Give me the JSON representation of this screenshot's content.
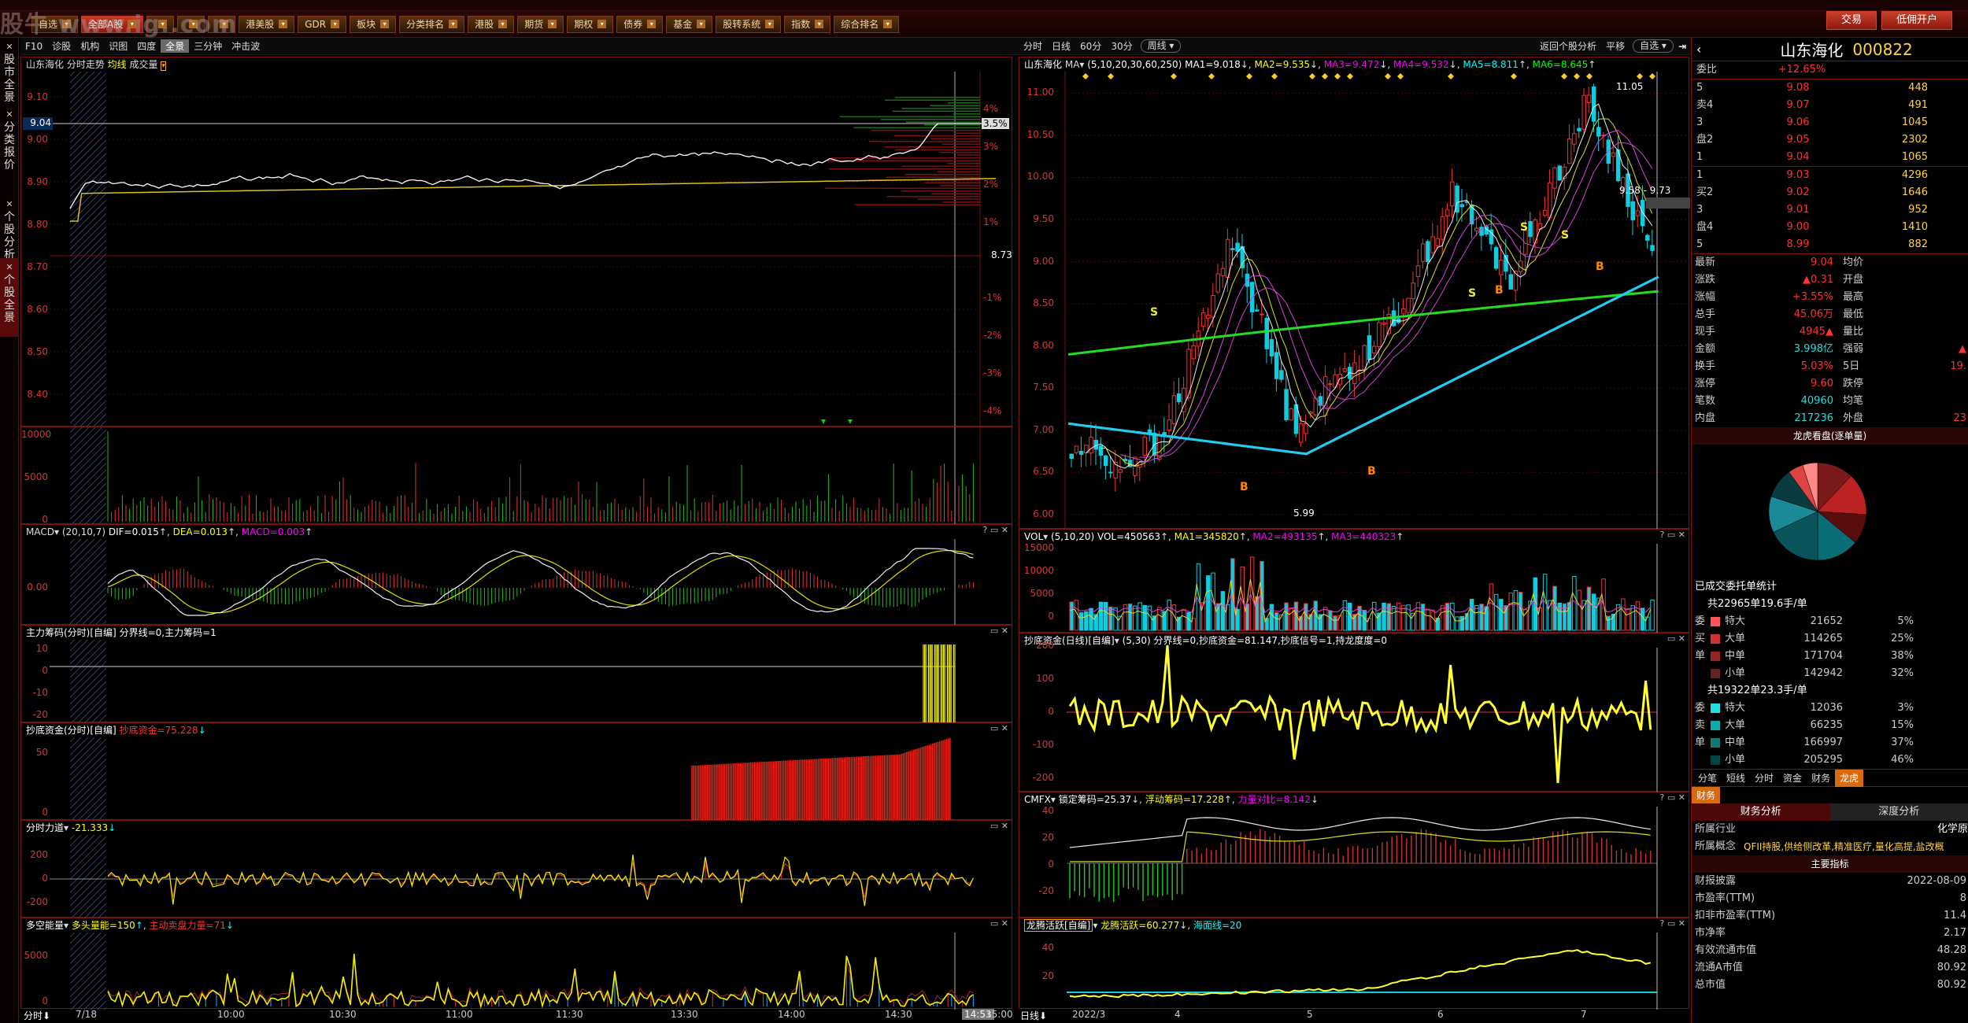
{
  "app": {
    "logo": "股牛 www.ig..com",
    "top_menu": [
      "自选",
      "全部A股",
      "",
      "",
      "",
      "港美股",
      "GDR",
      "板块",
      "分类排名",
      "港股",
      "期货",
      "期权",
      "债券",
      "基金",
      "股转系统",
      "指数",
      "综合排名"
    ],
    "trade_buttons": [
      "交易",
      "低佣开户"
    ]
  },
  "left_tabs": [
    {
      "label": "股市全景"
    },
    {
      "label": "分类报价"
    },
    {
      "label": "个股分析"
    },
    {
      "label": "个股全景"
    }
  ],
  "left_toolbar": [
    "F10",
    "诊股",
    "机构",
    "识图",
    "四度",
    "全景",
    "三分钟",
    "冲击波"
  ],
  "mid_toolbar": {
    "tabs": [
      "分时",
      "日线",
      "60分",
      "30分"
    ],
    "period_select": "周线",
    "right_links": [
      "返回个股分析",
      "平移"
    ],
    "watch_select": "自选"
  },
  "intraday": {
    "title": "山东海化 分时走势",
    "avg_label": "均线",
    "vol_label": "成交量",
    "price_axis": [
      "9.10",
      "9.00",
      "8.90",
      "8.80",
      "8.70",
      "8.60",
      "8.50",
      "8.40"
    ],
    "current_price_tag": "9.04",
    "pct_axis": [
      "4%",
      "3%",
      "2%",
      "1%",
      "",
      "-1%",
      "-2%",
      "-3%",
      "-4%"
    ],
    "pct_tag": "3.5%",
    "preclose_label": "8.73",
    "vol_axis": [
      "10000",
      "5000",
      "0"
    ],
    "macd": {
      "title": "MACD",
      "params": "(20,10,7)",
      "dif": "DIF=0.015",
      "dea": "DEA=0.013",
      "macd": "MACD=0.003",
      "axis": [
        "0.00"
      ]
    },
    "zlcm": {
      "title": "主力筹码(分时)[自编]",
      "params": "分界线=0,主力筹码=1",
      "axis": [
        "10",
        "0",
        "-10",
        "-20"
      ]
    },
    "cdzj": {
      "title": "抄底资金(分时)[自编]",
      "params": "抄底资金=75.228",
      "axis": [
        "50",
        "0"
      ]
    },
    "fsld": {
      "title": "分时力道",
      "params": "-21.333",
      "axis": [
        "200",
        "0",
        "-200"
      ]
    },
    "dknl": {
      "title": "多空能量",
      "params": "多头量能=150",
      "params2": "主动卖盘力量=71",
      "axis": [
        "5000",
        "0"
      ]
    },
    "time_axis": [
      "7/18",
      "10:00",
      "10:30",
      "11:00",
      "11:30",
      "13:30",
      "14:00",
      "14:30",
      "14:53",
      "15:00"
    ],
    "time_btn": "分时"
  },
  "daily": {
    "title": "山东海化",
    "ma_label": "MA",
    "ma_params": "(5,10,20,30,60,250)",
    "ma": [
      "MA1=9.018",
      "MA2=9.535",
      "MA3=9.472",
      "MA4=9.532",
      "MA5=8.811",
      "MA6=8.645"
    ],
    "price_axis": [
      "11.00",
      "10.50",
      "10.00",
      "9.50",
      "9.00",
      "8.50",
      "8.00",
      "7.50",
      "7.00",
      "6.50",
      "6.00"
    ],
    "high_label": "11.05",
    "low_label": "5.99",
    "range_label": "9.58 - 9.73",
    "vol": {
      "title": "VOL",
      "params": "(5,10,20)",
      "v": "VOL=450563",
      "ma1": "MA1=345820",
      "ma2": "MA2=493135",
      "ma3": "MA3=440323",
      "axis": [
        "15000",
        "10000",
        "5000",
        "0"
      ]
    },
    "cdzj": {
      "title": "抄底资金(日线)[自编]",
      "params": "(5,30)",
      "body": "分界线=0,抄底资金=81.147,抄底信号=1,持龙度度=0",
      "axis": [
        "200",
        "100",
        "0",
        "-100",
        "-200"
      ]
    },
    "cmfx": {
      "title": "CMFX",
      "lock": "锁定筹码=25.37",
      "float": "浮动筹码=17.228",
      "ratio": "力量对比=8.142",
      "axis": [
        "40",
        "20",
        "0",
        "-20"
      ]
    },
    "ltnh": {
      "title": "龙腾活跃[自编]",
      "body": "龙腾活跃=60.277",
      "sea": "海面线=20",
      "axis": [
        "40",
        "20"
      ]
    },
    "x_axis": [
      "2022/3",
      "4",
      "5",
      "6",
      "7"
    ],
    "period_btn": "日线"
  },
  "quote": {
    "name": "山东海化",
    "code": "000822",
    "webi_label": "委比",
    "webi": "+12.65%",
    "asks": [
      {
        "l": "5",
        "p": "9.08",
        "v": "448"
      },
      {
        "l": "卖4",
        "p": "9.07",
        "v": "491"
      },
      {
        "l": "3",
        "p": "9.06",
        "v": "1045"
      },
      {
        "l": "盘2",
        "p": "9.05",
        "v": "2302"
      },
      {
        "l": "1",
        "p": "9.04",
        "v": "1065"
      }
    ],
    "bids": [
      {
        "l": "1",
        "p": "9.03",
        "v": "4296"
      },
      {
        "l": "买2",
        "p": "9.02",
        "v": "1646"
      },
      {
        "l": "3",
        "p": "9.01",
        "v": "952"
      },
      {
        "l": "盘4",
        "p": "9.00",
        "v": "1410"
      },
      {
        "l": "5",
        "p": "8.99",
        "v": "882"
      }
    ],
    "stats": [
      [
        "最新",
        "9.04",
        "均价",
        ""
      ],
      [
        "涨跌",
        "▲0.31",
        "开盘",
        ""
      ],
      [
        "涨幅",
        "+3.55%",
        "最高",
        ""
      ],
      [
        "总手",
        "45.06万",
        "最低",
        ""
      ],
      [
        "现手",
        "4945▲",
        "量比",
        ""
      ],
      [
        "金额",
        "3.998亿",
        "强弱",
        "▲"
      ],
      [
        "换手",
        "5.03%",
        "5日",
        "19."
      ],
      [
        "涨停",
        "9.60",
        "跌停",
        ""
      ],
      [
        "笔数",
        "40960",
        "均笔",
        ""
      ],
      [
        "内盘",
        "217236",
        "外盘",
        "23"
      ]
    ],
    "pie_title": "龙虎看盘(逐单量)",
    "pie": [
      {
        "v": 12,
        "c": "#7a1a1a"
      },
      {
        "v": 14,
        "c": "#b22"
      },
      {
        "v": 10,
        "c": "#5a0d0d"
      },
      {
        "v": 14,
        "c": "#0b6d76"
      },
      {
        "v": 18,
        "c": "#0a555c"
      },
      {
        "v": 12,
        "c": "#1a8a96"
      },
      {
        "v": 10,
        "c": "#083c40"
      },
      {
        "v": 5,
        "c": "#d44"
      },
      {
        "v": 5,
        "c": "#f88"
      }
    ],
    "order_title": "已成交委托单统计",
    "buy_total": "共22965单19.6手/单",
    "buy": [
      {
        "s": "委",
        "n": "特大",
        "v": "21652",
        "p": "5%",
        "c": "#f55"
      },
      {
        "s": "买",
        "n": "大单",
        "v": "114265",
        "p": "25%",
        "c": "#c33"
      },
      {
        "s": "单",
        "n": "中单",
        "v": "171704",
        "p": "38%",
        "c": "#922"
      },
      {
        "s": "",
        "n": "小单",
        "v": "142942",
        "p": "32%",
        "c": "#622"
      }
    ],
    "sell_total": "共19322单23.3手/单",
    "sell": [
      {
        "s": "委",
        "n": "特大",
        "v": "12036",
        "p": "3%",
        "c": "#2dd"
      },
      {
        "s": "卖",
        "n": "大单",
        "v": "66235",
        "p": "15%",
        "c": "#1aa"
      },
      {
        "s": "单",
        "n": "中单",
        "v": "166997",
        "p": "37%",
        "c": "#177"
      },
      {
        "s": "",
        "n": "小单",
        "v": "205295",
        "p": "46%",
        "c": "#044"
      }
    ],
    "bottom_tabs": [
      "分笔",
      "短线",
      "分时",
      "资金",
      "财务",
      "龙虎"
    ],
    "fin_tab": "财务",
    "fin_tabs": [
      "财务分析",
      "深度分析"
    ],
    "industry_label": "所属行业",
    "industry": "化学原",
    "concept_label": "所属概念",
    "concept": "QFII持股,供给侧改革,精准医疗,量化高提,盐改概",
    "key_title": "主要指标",
    "fin": [
      [
        "财报披露",
        "2022-08-09"
      ],
      [
        "市盈率(TTM)",
        "8"
      ],
      [
        "扣非市盈率(TTM)",
        "11.4"
      ],
      [
        "市净率",
        "2.17"
      ],
      [
        "有效流通市值",
        "48.28"
      ],
      [
        "流通A市值",
        "80.92"
      ],
      [
        "总市值",
        "80.92"
      ]
    ]
  }
}
